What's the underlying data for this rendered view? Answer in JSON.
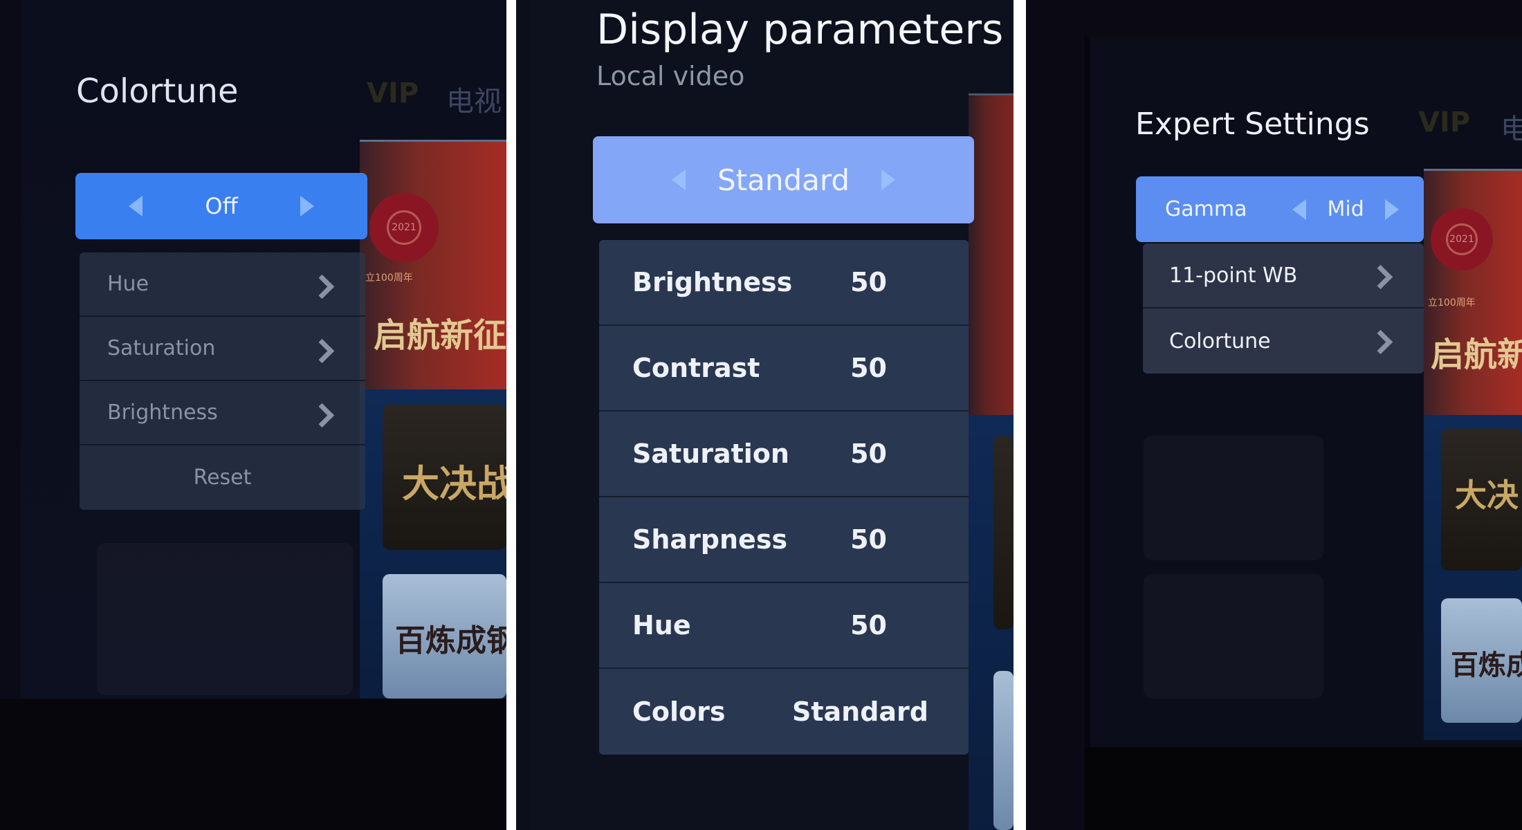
{
  "panels": {
    "colortune": {
      "title": "Colortune",
      "mode": {
        "value": "Off"
      },
      "items": [
        {
          "label": "Hue"
        },
        {
          "label": "Saturation"
        },
        {
          "label": "Brightness"
        }
      ],
      "reset_label": "Reset",
      "background": {
        "nav_vip": "VIP",
        "nav_tv": "电视",
        "banner_slogan": "启航新征",
        "banner_sub": "立100周年",
        "banner_year": "2021",
        "poster1": "大决战",
        "poster2": "百炼成钢"
      }
    },
    "display_parameters": {
      "title": "Display parameters",
      "subtitle": "Local video",
      "mode": {
        "value": "Standard"
      },
      "items": [
        {
          "label": "Brightness",
          "value": "50"
        },
        {
          "label": "Contrast",
          "value": "50"
        },
        {
          "label": "Saturation",
          "value": "50"
        },
        {
          "label": "Sharpness",
          "value": "50"
        },
        {
          "label": "Hue",
          "value": "50"
        },
        {
          "label": "Colors",
          "value": "Standard"
        }
      ]
    },
    "expert_settings": {
      "title": "Expert Settings",
      "gamma": {
        "label": "Gamma",
        "value": "Mid"
      },
      "items": [
        {
          "label": "11-point WB"
        },
        {
          "label": "Colortune"
        }
      ],
      "background": {
        "nav_vip": "VIP",
        "nav_tv": "电",
        "banner_slogan": "启航新",
        "banner_sub": "立100周年",
        "banner_year": "2021",
        "poster1": "大决",
        "poster2": "百炼成"
      }
    }
  },
  "colors": {
    "selector_blue_p1": "#3a7ff0",
    "selector_blue_p2": "#84a6f6",
    "selector_blue_p3": "#5b8ef0"
  }
}
